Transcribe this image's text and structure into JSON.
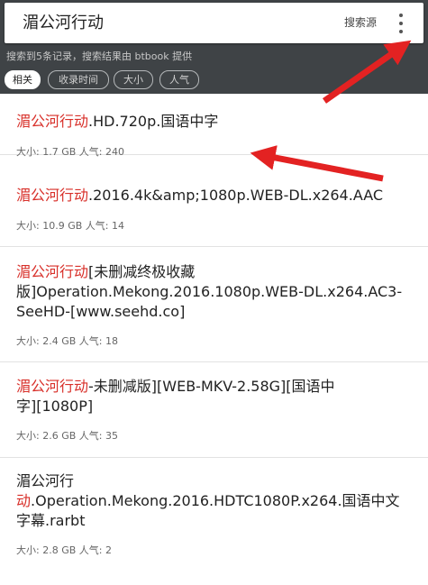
{
  "search": {
    "query": "湄公河行动",
    "source_label": "搜索源"
  },
  "info_text": "搜索到5条记录，搜索结果由 btbook 提供",
  "sort_tabs": [
    "相关",
    "收录时间",
    "大小",
    "人气"
  ],
  "results": [
    {
      "lines": [
        {
          "hl": "湄公河行动",
          "rest": ".HD.720p.国语中字"
        }
      ],
      "meta": "大小: 1.7 GB 人气: 240"
    },
    {
      "lines": [
        {
          "hl": "湄公河行动",
          "rest": ".2016.4k&amp;1080p.WEB-DL.x264.AAC"
        }
      ],
      "meta": "大小: 10.9 GB 人气: 14"
    },
    {
      "lines": [
        {
          "hl": "湄公河行动",
          "rest": "[未删减终极收藏"
        },
        {
          "hl": "",
          "rest": "版]Operation.Mekong.2016.1080p.WEB-DL.x264.AC3-"
        },
        {
          "hl": "",
          "rest": "SeeHD-[www.seehd.co]"
        }
      ],
      "meta": "大小: 2.4 GB 人气: 18"
    },
    {
      "lines": [
        {
          "hl": "湄公河行动",
          "rest": "-未删减版][WEB-MKV-2.58G][国语中"
        },
        {
          "hl": "",
          "rest": "字][1080P]"
        }
      ],
      "meta": "大小: 2.6 GB 人气: 35"
    },
    {
      "lines": [
        {
          "hl": "湄公河行",
          "rest": ""
        },
        {
          "hl": "动",
          "rest": ".Operation.Mekong.2016.HDTC1080P.x264.国语中文"
        },
        {
          "hl": "",
          "rest": "字幕.rarbt"
        }
      ],
      "meta": "大小: 2.8 GB 人气: 2"
    }
  ],
  "colors": {
    "header": "#3f4346",
    "highlight": "#d8302a",
    "arrow": "#e32222"
  },
  "icons": {
    "more": "more-vert-icon"
  }
}
